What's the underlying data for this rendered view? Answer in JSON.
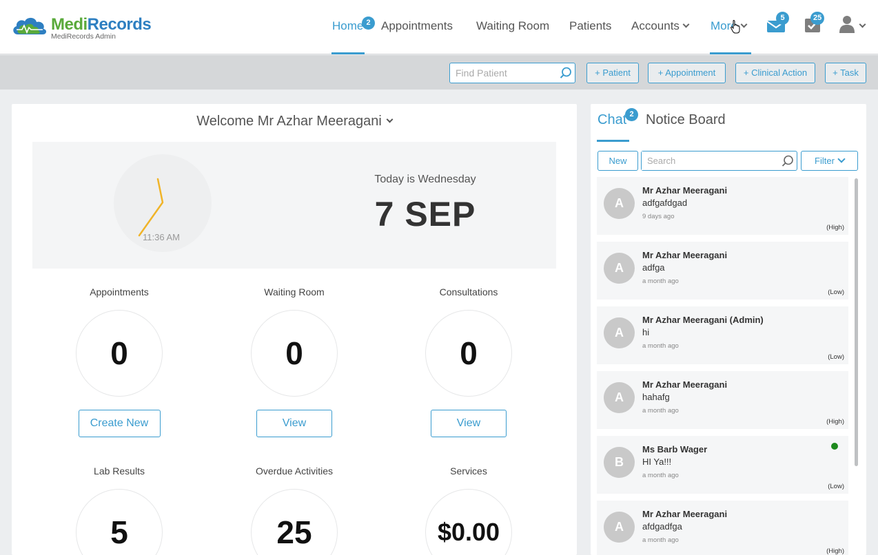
{
  "brand": {
    "name_part1": "Medi",
    "name_part2": "Records",
    "subtitle": "MediRecords Admin"
  },
  "nav": {
    "items": [
      {
        "label": "Home",
        "badge": "2"
      },
      {
        "label": "Appointments"
      },
      {
        "label": "Waiting Room"
      },
      {
        "label": "Patients"
      },
      {
        "label": "Accounts"
      },
      {
        "label": "More"
      }
    ],
    "mail_badge": "5",
    "tasks_badge": "25"
  },
  "toolbar": {
    "find_placeholder": "Find Patient",
    "add_patient": "+ Patient",
    "add_appointment": "+ Appointment",
    "add_clinical_action": "+ Clinical Action",
    "add_task": "+ Task"
  },
  "dashboard": {
    "welcome": "Welcome Mr Azhar Meeragani",
    "clock_time": "11:36 AM",
    "today_label": "Today is Wednesday",
    "date": "7 SEP",
    "stats": [
      {
        "label": "Appointments",
        "value": "0",
        "button": "Create New"
      },
      {
        "label": "Waiting Room",
        "value": "0",
        "button": "View"
      },
      {
        "label": "Consultations",
        "value": "0",
        "button": "View"
      },
      {
        "label": "Lab Results",
        "value": "5"
      },
      {
        "label": "Overdue Activities",
        "value": "25"
      },
      {
        "label": "Services",
        "value": "$0.00"
      }
    ]
  },
  "chat": {
    "tab_chat": "Chat",
    "tab_chat_badge": "2",
    "tab_notice": "Notice Board",
    "new_label": "New",
    "search_placeholder": "Search",
    "filter_label": "Filter",
    "messages": [
      {
        "initial": "A",
        "name": "Mr Azhar Meeragani",
        "text": "adfgafdgad",
        "time": "9 days ago",
        "priority": "(High)",
        "online": false
      },
      {
        "initial": "A",
        "name": "Mr Azhar Meeragani",
        "text": "adfga",
        "time": "a month ago",
        "priority": "(Low)",
        "online": false
      },
      {
        "initial": "A",
        "name": "Mr Azhar Meeragani (Admin)",
        "text": "hi",
        "time": "a month ago",
        "priority": "(Low)",
        "online": false
      },
      {
        "initial": "A",
        "name": "Mr Azhar Meeragani",
        "text": "hahafg",
        "time": "a month ago",
        "priority": "(High)",
        "online": false
      },
      {
        "initial": "B",
        "name": "Ms Barb Wager",
        "text": "HI Ya!!!",
        "time": "a month ago",
        "priority": "(Low)",
        "online": true
      },
      {
        "initial": "A",
        "name": "Mr Azhar Meeragani",
        "text": "afdgadfga",
        "time": "a month ago",
        "priority": "(High)",
        "online": false
      }
    ]
  }
}
